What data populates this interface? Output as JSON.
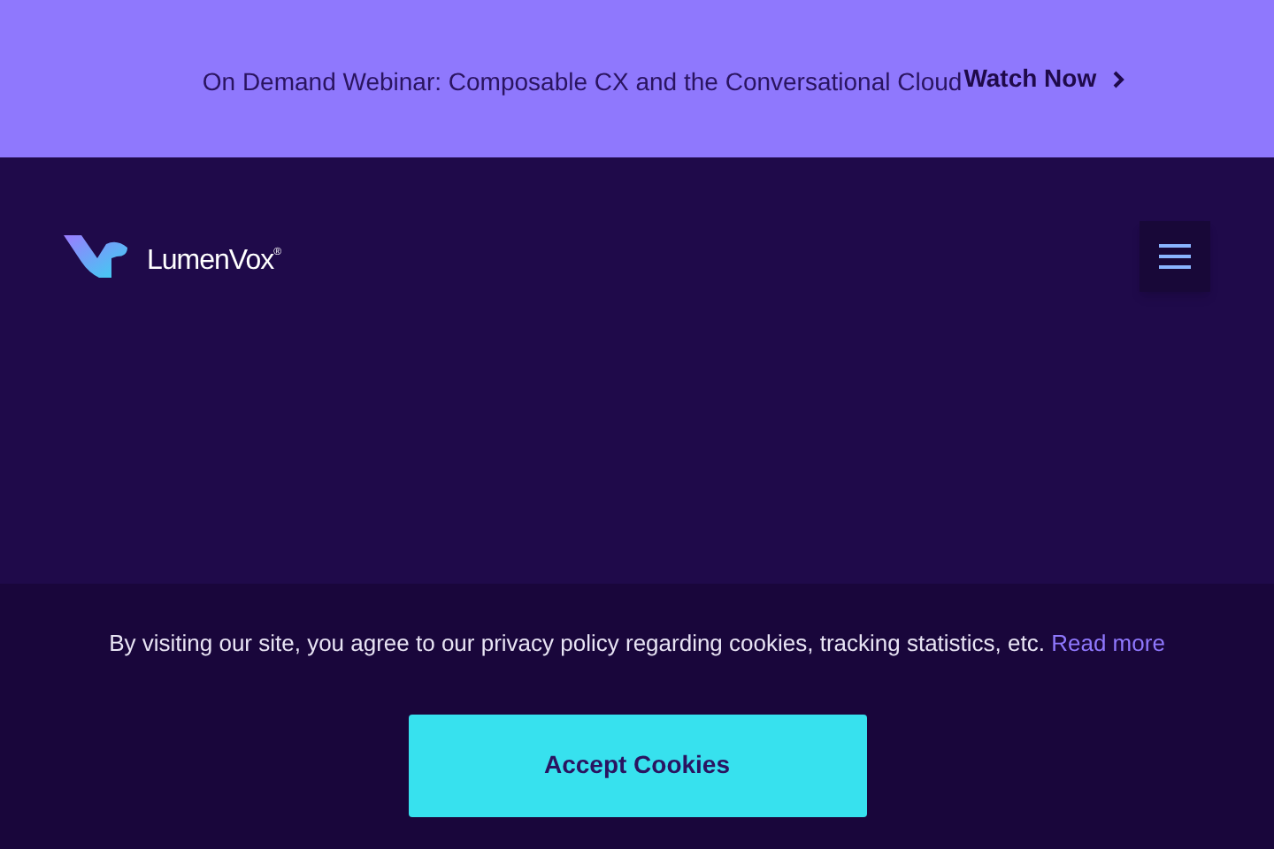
{
  "announcement": {
    "text": "On Demand Webinar: Composable CX and the Conversational Cloud",
    "link": "Watch Now"
  },
  "header": {
    "logo_text": "LumenVox",
    "logo_mark": "®"
  },
  "cookie_banner": {
    "text": "By visiting our site, you agree to our privacy policy regarding cookies, tracking statistics, etc.",
    "link": "Read more",
    "button": "Accept Cookies"
  }
}
